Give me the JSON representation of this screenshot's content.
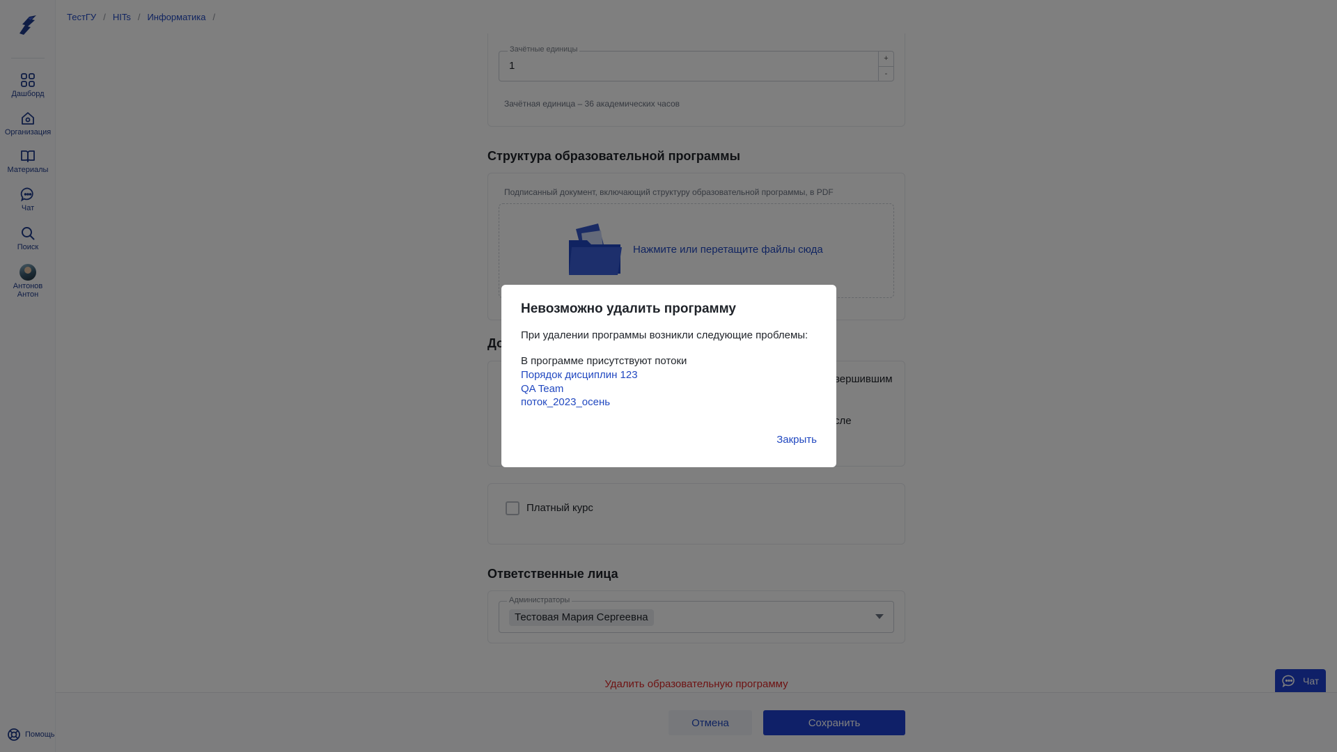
{
  "sidebar": {
    "items": [
      {
        "label": "Дашборд",
        "icon": "dashboard-icon"
      },
      {
        "label": "Организация",
        "icon": "home-icon"
      },
      {
        "label": "Материалы",
        "icon": "book-icon"
      },
      {
        "label": "Чат",
        "icon": "chat-bubble-icon"
      },
      {
        "label": "Поиск",
        "icon": "search-icon"
      }
    ],
    "user": {
      "first_line": "Антонов",
      "second_line": "Антон"
    },
    "help_label": "Помощь"
  },
  "breadcrumb": {
    "items": [
      "ТестГУ",
      "HITs",
      "Информатика"
    ],
    "separator": "/"
  },
  "credits": {
    "label": "Зачётные единицы",
    "value": "1",
    "increment": "+",
    "decrement": "-",
    "hint": "Зачётная единица – 36 академических часов"
  },
  "structure": {
    "title": "Структура образовательной программы",
    "description": "Подписанный документ, включающий структуру образовательной программы, в PDF",
    "dropzone_text": "Нажмите или перетащите файлы сюда"
  },
  "obscured": {
    "title_fragment": "До",
    "line1_fragment": "вершившим",
    "line2_fragment": "сле"
  },
  "paid_course": {
    "label": "Платный курс",
    "checked": false
  },
  "responsible": {
    "title": "Ответственные лица",
    "admins_label": "Администраторы",
    "admins": [
      "Тестовая Мария Сергеевна"
    ]
  },
  "delete_link": "Удалить образовательную программу",
  "footer": {
    "cancel": "Отмена",
    "save": "Сохранить"
  },
  "chat_widget": {
    "label": "Чат"
  },
  "modal": {
    "title": "Невозможно удалить программу",
    "message": "При удалении программы возникли следующие проблемы:",
    "problem": "В программе присутствуют потоки",
    "streams": [
      "Порядок дисциплин 123",
      "QA Team",
      "поток_2023_осень"
    ],
    "close": "Закрыть"
  },
  "colors": {
    "accent": "#1e40d0",
    "link": "#2148c0",
    "danger": "#dc2626",
    "overlay": "rgba(0,0,0,0.5)"
  }
}
